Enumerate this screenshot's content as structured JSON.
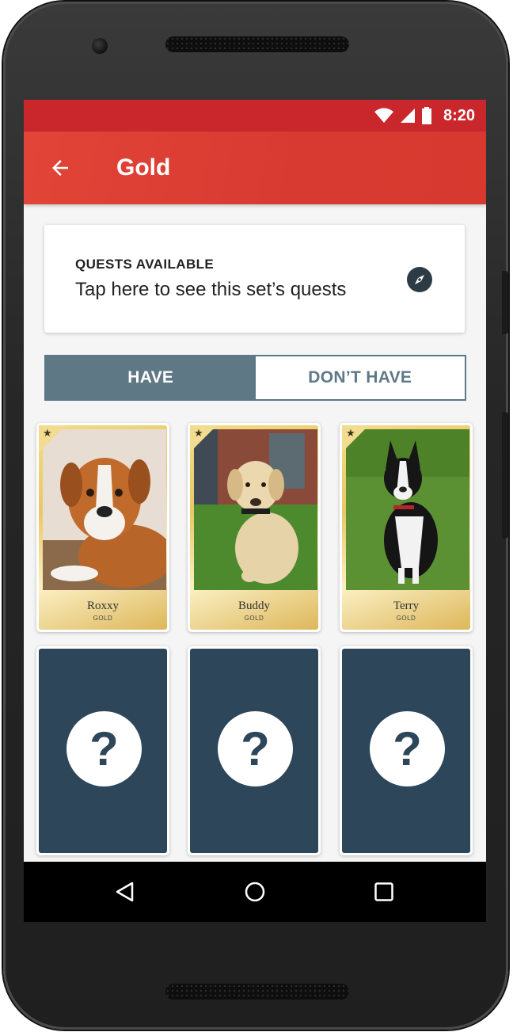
{
  "status_bar": {
    "time": "8:20",
    "icons": [
      "wifi-icon",
      "signal-icon",
      "battery-icon"
    ]
  },
  "app_bar": {
    "title": "Gold",
    "back_icon": "arrow-back-icon"
  },
  "quest_card": {
    "heading": "QUESTS AVAILABLE",
    "subtitle": "Tap here to see this set’s quests",
    "icon": "compass-icon"
  },
  "toggle": {
    "have_label": "HAVE",
    "dont_have_label": "DON’T HAVE",
    "selected": "HAVE"
  },
  "cards": [
    {
      "name": "Roxxy",
      "rarity": "GOLD",
      "star_icon": "star-icon"
    },
    {
      "name": "Buddy",
      "rarity": "GOLD",
      "star_icon": "star-icon"
    },
    {
      "name": "Terry",
      "rarity": "GOLD",
      "star_icon": "star-icon"
    }
  ],
  "unknown_cards": [
    {
      "symbol": "?"
    },
    {
      "symbol": "?"
    },
    {
      "symbol": "?"
    }
  ],
  "nav_bar": {
    "icons": [
      "back-triangle-icon",
      "home-circle-icon",
      "recents-square-icon"
    ]
  },
  "colors": {
    "status_bar": "#c9272b",
    "app_bar": "#e24437",
    "toggle_active": "#5e7886",
    "unknown_card": "#2d4659",
    "gold": "#e9c766"
  }
}
